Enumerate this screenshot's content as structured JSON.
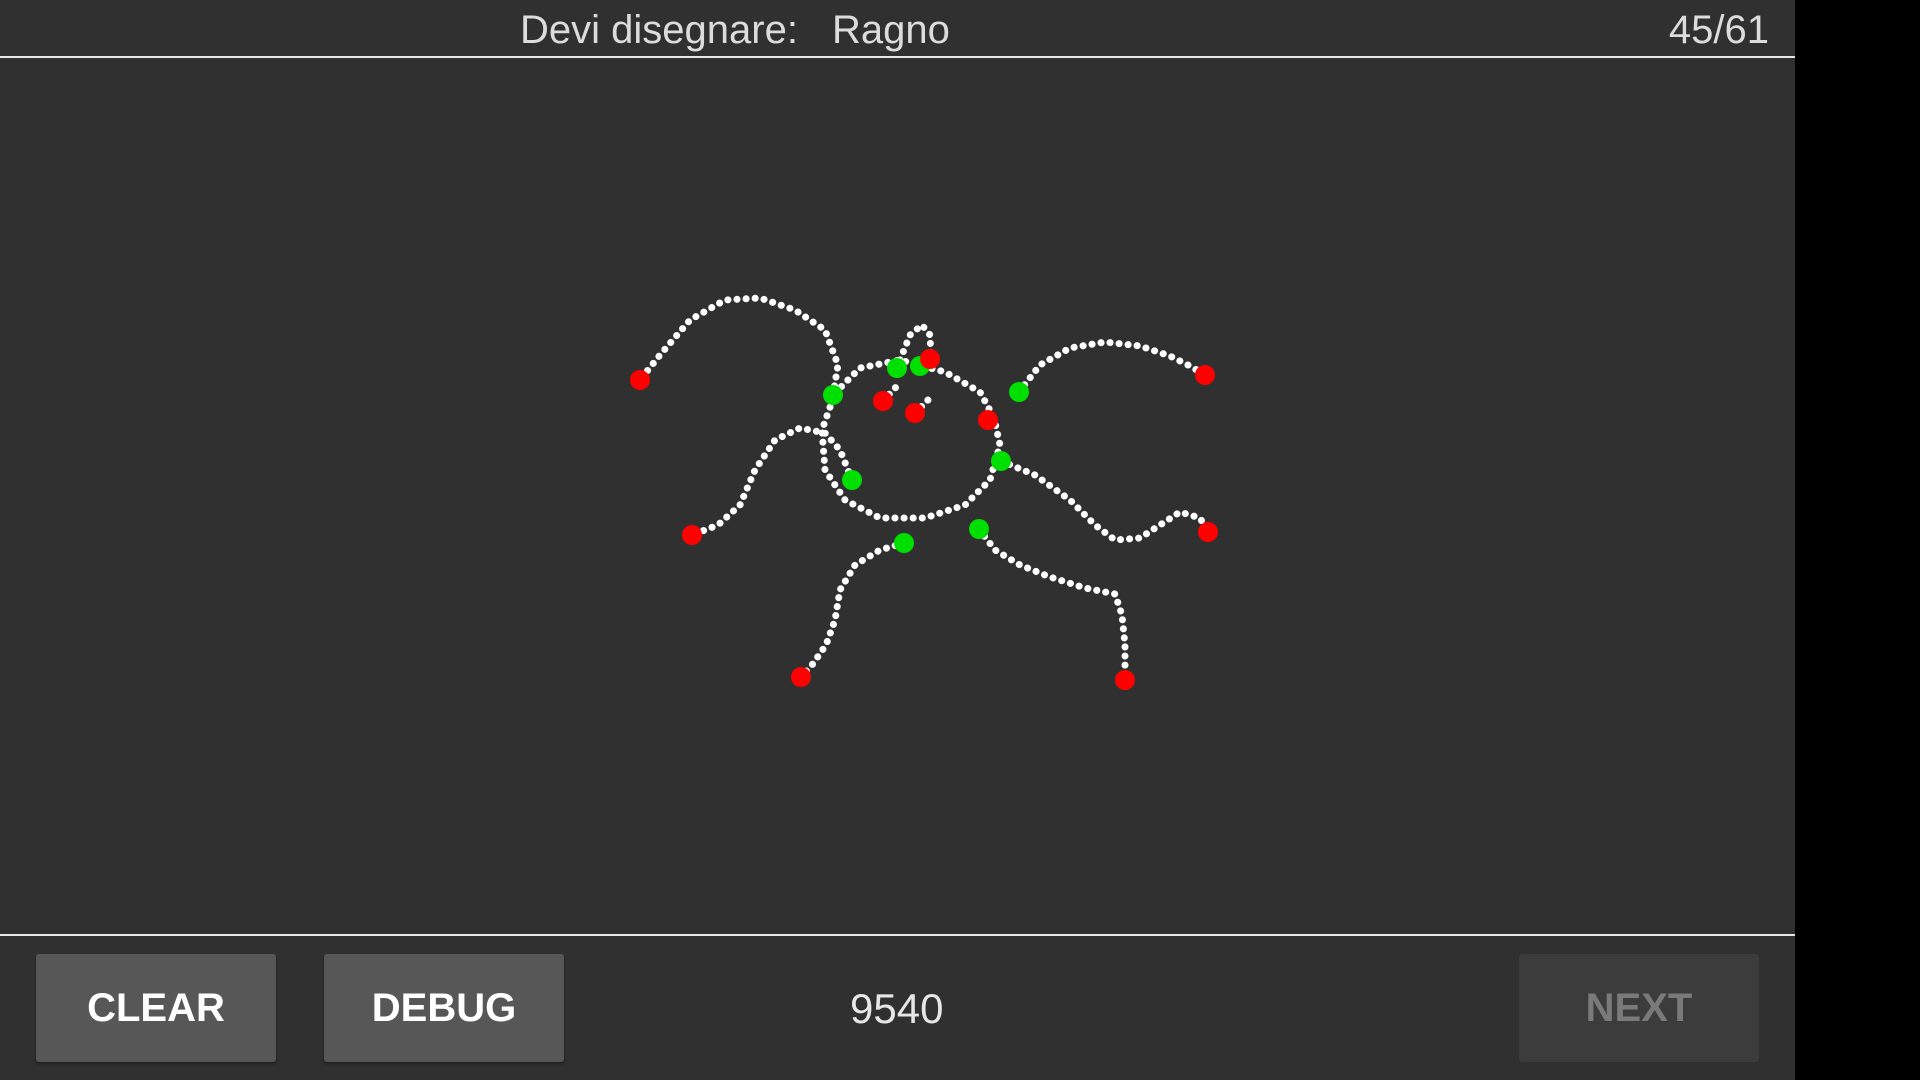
{
  "header": {
    "prompt_label": "Devi disegnare:",
    "target_word": "Ragno",
    "progress": "45/61"
  },
  "footer": {
    "clear_label": "CLEAR",
    "debug_label": "DEBUG",
    "score": "9540",
    "next_label": "NEXT"
  },
  "colors": {
    "stroke_dot": "#ffffff",
    "start_point": "#00e000",
    "end_point": "#ff0000",
    "background": "#303030"
  }
}
